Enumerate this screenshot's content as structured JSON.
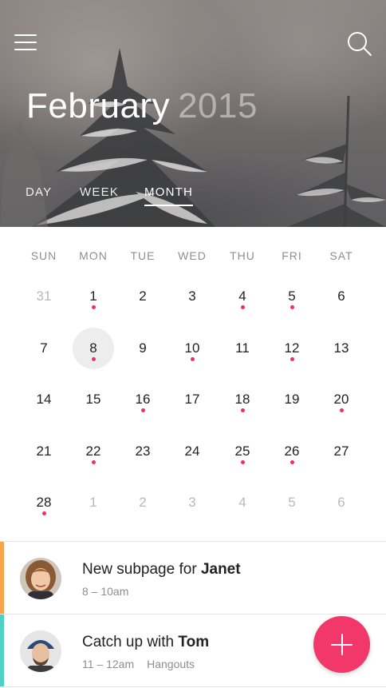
{
  "header": {
    "month": "February",
    "year": "2015",
    "tabs": [
      {
        "label": "DAY"
      },
      {
        "label": "WEEK"
      },
      {
        "label": "MONTH",
        "active": true
      }
    ]
  },
  "calendar": {
    "weekdays": [
      "SUN",
      "MON",
      "TUE",
      "WED",
      "THU",
      "FRI",
      "SAT"
    ],
    "weeks": [
      [
        {
          "d": "31",
          "muted": true
        },
        {
          "d": "1",
          "dot": true
        },
        {
          "d": "2"
        },
        {
          "d": "3"
        },
        {
          "d": "4",
          "dot": true
        },
        {
          "d": "5",
          "dot": true
        },
        {
          "d": "6"
        }
      ],
      [
        {
          "d": "7"
        },
        {
          "d": "8",
          "dot": true,
          "selected": true
        },
        {
          "d": "9"
        },
        {
          "d": "10",
          "dot": true
        },
        {
          "d": "11"
        },
        {
          "d": "12",
          "dot": true
        },
        {
          "d": "13"
        }
      ],
      [
        {
          "d": "14"
        },
        {
          "d": "15"
        },
        {
          "d": "16",
          "dot": true
        },
        {
          "d": "17"
        },
        {
          "d": "18",
          "dot": true
        },
        {
          "d": "19"
        },
        {
          "d": "20",
          "dot": true
        }
      ],
      [
        {
          "d": "21"
        },
        {
          "d": "22",
          "dot": true
        },
        {
          "d": "23"
        },
        {
          "d": "24"
        },
        {
          "d": "25",
          "dot": true
        },
        {
          "d": "26",
          "dot": true
        },
        {
          "d": "27"
        }
      ],
      [
        {
          "d": "28",
          "dot": true
        },
        {
          "d": "1",
          "muted": true
        },
        {
          "d": "2",
          "muted": true
        },
        {
          "d": "3",
          "muted": true
        },
        {
          "d": "4",
          "muted": true
        },
        {
          "d": "5",
          "muted": true
        },
        {
          "d": "6",
          "muted": true
        }
      ]
    ]
  },
  "events": [
    {
      "title": "New subpage for",
      "person": "Janet",
      "time": "8 – 10am",
      "place": "",
      "color": "#f7a44a"
    },
    {
      "title": "Catch up with",
      "person": "Tom",
      "time": "11 – 12am",
      "place": "Hangouts",
      "color": "#4fd1c5"
    }
  ],
  "colors": {
    "accent": "#f2386a",
    "dot": "#f12f62"
  },
  "icons": {
    "menu": "hamburger-menu-icon",
    "search": "search-icon",
    "add": "plus-icon"
  }
}
